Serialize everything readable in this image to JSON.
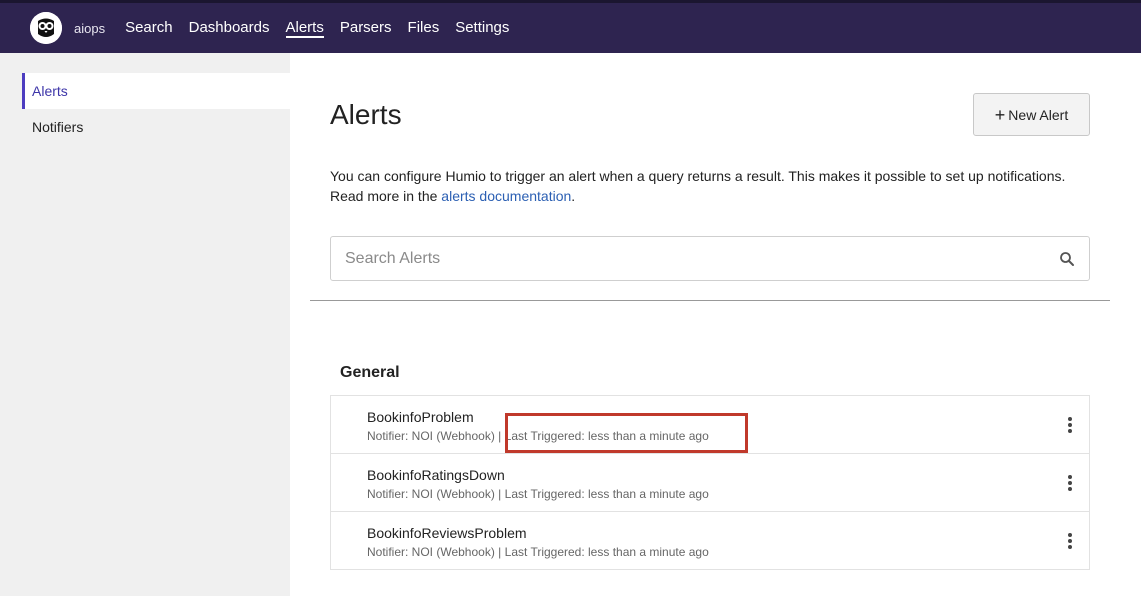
{
  "topbar": {
    "org": "aiops",
    "nav": [
      "Search",
      "Dashboards",
      "Alerts",
      "Parsers",
      "Files",
      "Settings"
    ],
    "active_nav": "Alerts"
  },
  "sidebar": {
    "items": [
      {
        "label": "Alerts",
        "active": true
      },
      {
        "label": "Notifiers",
        "active": false
      }
    ]
  },
  "main": {
    "title": "Alerts",
    "new_alert_label": "New Alert",
    "description_prefix": "You can configure Humio to trigger an alert when a query returns a result. This makes it possible to set up notifications. Read more in the ",
    "description_link": "alerts documentation",
    "description_suffix": ".",
    "search_placeholder": "Search Alerts",
    "group_title": "General",
    "alerts": [
      {
        "name": "BookinfoProblem",
        "notifier": "Notifier: NOI (Webhook)",
        "separator": "|",
        "last_triggered": "Last Triggered: less than a minute ago"
      },
      {
        "name": "BookinfoRatingsDown",
        "notifier": "Notifier: NOI (Webhook)",
        "separator": "|",
        "last_triggered": "Last Triggered: less than a minute ago"
      },
      {
        "name": "BookinfoReviewsProblem",
        "notifier": "Notifier: NOI (Webhook)",
        "separator": "|",
        "last_triggered": "Last Triggered: less than a minute ago"
      }
    ]
  },
  "colors": {
    "topbar": "#2e2450",
    "accent": "#4d3dc0",
    "link": "#2b5fb3",
    "highlight": "#c0392b"
  }
}
